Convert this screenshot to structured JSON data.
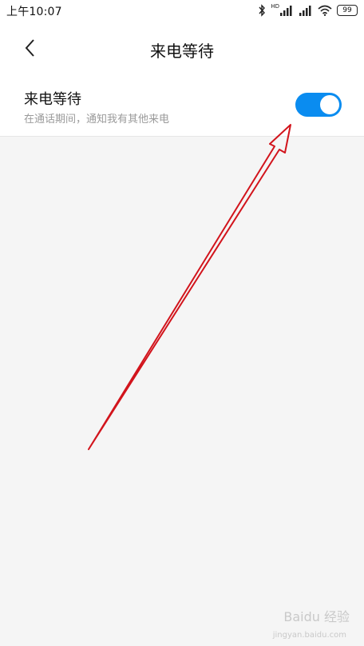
{
  "status_bar": {
    "time": "上午10:07",
    "network_label": "HD",
    "battery": "99"
  },
  "header": {
    "title": "来电等待"
  },
  "setting": {
    "title": "来电等待",
    "description": "在通话期间，通知我有其他来电",
    "enabled": true
  },
  "watermark": {
    "brand": "Baidu 经验",
    "url": "jingyan.baidu.com"
  },
  "colors": {
    "accent": "#0a8cf0",
    "annotation_arrow": "#d2141c",
    "background": "#f5f5f5"
  },
  "icons": [
    "bluetooth-icon",
    "signal-icon",
    "wifi-icon",
    "battery-icon",
    "back-arrow-icon"
  ]
}
